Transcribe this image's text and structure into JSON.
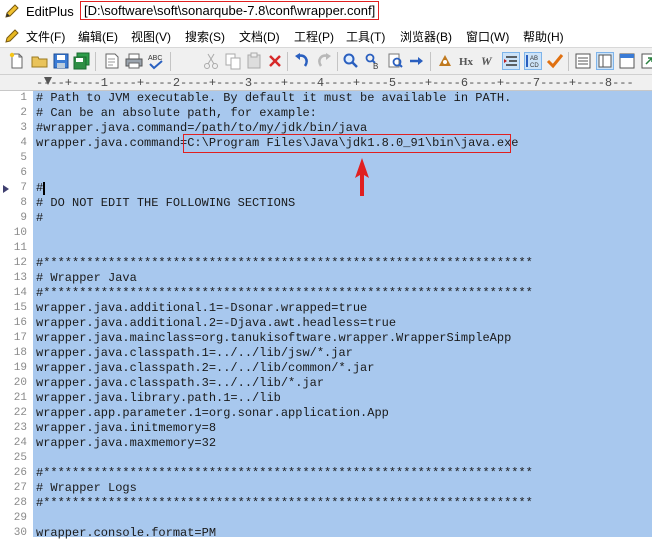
{
  "titlebar": {
    "app_name": "EditPlus",
    "separator": "-",
    "file_path": "[D:\\software\\soft\\sonarqube-7.8\\conf\\wrapper.conf]"
  },
  "menu": {
    "items": [
      "文件(F)",
      "编辑(E)",
      "视图(V)",
      "搜索(S)",
      "文档(D)",
      "工程(P)",
      "工具(T)",
      "浏览器(B)",
      "窗口(W)",
      "帮助(H)"
    ]
  },
  "toolbar": {
    "icons": [
      "new-file-icon",
      "open-folder-icon",
      "save-icon",
      "save-all-icon",
      "print-preview-icon",
      "print-icon",
      "spell-check-icon",
      "cut-icon",
      "copy-icon",
      "paste-icon",
      "delete-icon",
      "undo-icon",
      "redo-icon",
      "find-icon",
      "replace-icon",
      "find-in-files-icon",
      "go-to-line-icon",
      "bold-icon",
      "heading-icon",
      "word-wrap-icon",
      "indent-icon",
      "hex-view-icon",
      "check-mark-icon",
      "list-view-icon",
      "column-view-icon",
      "window-icon"
    ],
    "letters": {
      "heading": "Hx",
      "wrap": "W",
      "hex_top": "AB",
      "hex_bottom": "CD"
    }
  },
  "ruler": {
    "text": "----+----1----+----2----+----3----+----4----+----5----+----6----+----7----+----8---"
  },
  "editor": {
    "current_line": 7,
    "lines": [
      {
        "n": "1",
        "text": "# Path to JVM executable. By default it must be available in PATH."
      },
      {
        "n": "2",
        "text": "# Can be an absolute path, for example:"
      },
      {
        "n": "3",
        "text": "#wrapper.java.command=/path/to/my/jdk/bin/java"
      },
      {
        "n": "4",
        "text": "wrapper.java.command=C:\\Program Files\\Java\\jdk1.8.0_91\\bin\\java.exe"
      },
      {
        "n": "5",
        "text": ""
      },
      {
        "n": "6",
        "text": ""
      },
      {
        "n": "7",
        "text": "#"
      },
      {
        "n": "8",
        "text": "# DO NOT EDIT THE FOLLOWING SECTIONS"
      },
      {
        "n": "9",
        "text": "#"
      },
      {
        "n": "10",
        "text": ""
      },
      {
        "n": "11",
        "text": ""
      },
      {
        "n": "12",
        "text": "#********************************************************************"
      },
      {
        "n": "13",
        "text": "# Wrapper Java"
      },
      {
        "n": "14",
        "text": "#********************************************************************"
      },
      {
        "n": "15",
        "text": "wrapper.java.additional.1=-Dsonar.wrapped=true"
      },
      {
        "n": "16",
        "text": "wrapper.java.additional.2=-Djava.awt.headless=true"
      },
      {
        "n": "17",
        "text": "wrapper.java.mainclass=org.tanukisoftware.wrapper.WrapperSimpleApp"
      },
      {
        "n": "18",
        "text": "wrapper.java.classpath.1=../../lib/jsw/*.jar"
      },
      {
        "n": "19",
        "text": "wrapper.java.classpath.2=../../lib/common/*.jar"
      },
      {
        "n": "20",
        "text": "wrapper.java.classpath.3=../../lib/*.jar"
      },
      {
        "n": "21",
        "text": "wrapper.java.library.path.1=../lib"
      },
      {
        "n": "22",
        "text": "wrapper.app.parameter.1=org.sonar.application.App"
      },
      {
        "n": "23",
        "text": "wrapper.java.initmemory=8"
      },
      {
        "n": "24",
        "text": "wrapper.java.maxmemory=32"
      },
      {
        "n": "25",
        "text": ""
      },
      {
        "n": "26",
        "text": "#********************************************************************"
      },
      {
        "n": "27",
        "text": "# Wrapper Logs"
      },
      {
        "n": "28",
        "text": "#********************************************************************"
      },
      {
        "n": "29",
        "text": ""
      },
      {
        "n": "30",
        "text": "wrapper.console.format=PM"
      }
    ]
  },
  "colors": {
    "selection": "#a8c8ee",
    "annotation": "#e02020"
  }
}
